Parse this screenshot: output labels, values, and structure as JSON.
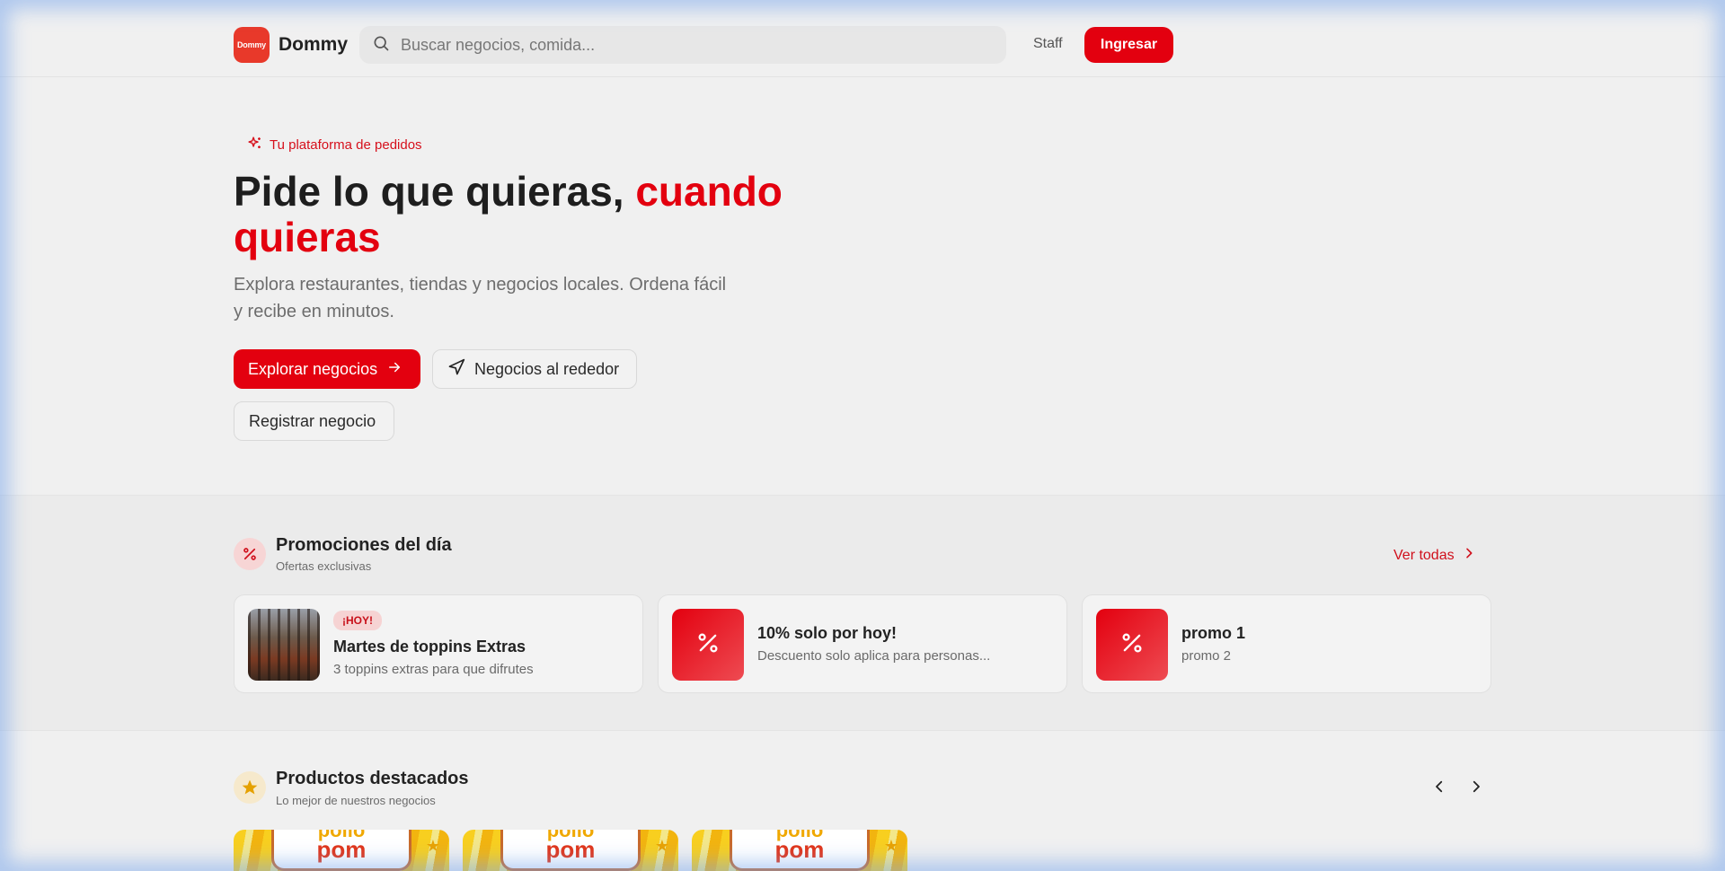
{
  "header": {
    "brand_logo_text": "Dommy",
    "brand_name": "Dommy",
    "search_placeholder": "Buscar negocios, comida...",
    "staff_label": "Staff",
    "login_label": "Ingresar"
  },
  "hero": {
    "tag": "Tu plataforma de pedidos",
    "title_main": "Pide lo que quieras, ",
    "title_accent": "cuando quieras",
    "subtitle": "Explora restaurantes, tiendas y negocios locales. Ordena fácil y recibe en minutos.",
    "explore_label": "Explorar negocios",
    "nearby_label": "Negocios al rededor",
    "register_label": "Registrar negocio"
  },
  "promotions": {
    "title": "Promociones del día",
    "subtitle": "Ofertas exclusivas",
    "see_all": "Ver todas",
    "items": [
      {
        "badge": "¡HOY!",
        "title": "Martes de toppins Extras",
        "desc": "3 toppins extras para que difrutes"
      },
      {
        "title": "10% solo por hoy!",
        "desc": "Descuento solo aplica para personas..."
      },
      {
        "title": "promo 1",
        "desc": "promo 2"
      }
    ]
  },
  "featured": {
    "title": "Productos destacados",
    "subtitle": "Lo mejor de nuestros negocios",
    "products": [
      {
        "logo_top": "pollo",
        "logo_bottom": "pom"
      },
      {
        "logo_top": "pollo",
        "logo_bottom": "pom"
      },
      {
        "logo_top": "pollo",
        "logo_bottom": "pom"
      }
    ]
  },
  "colors": {
    "brand_red": "#e3000f",
    "accent_text_red": "#d0101c",
    "star_gold": "#e5a100"
  }
}
